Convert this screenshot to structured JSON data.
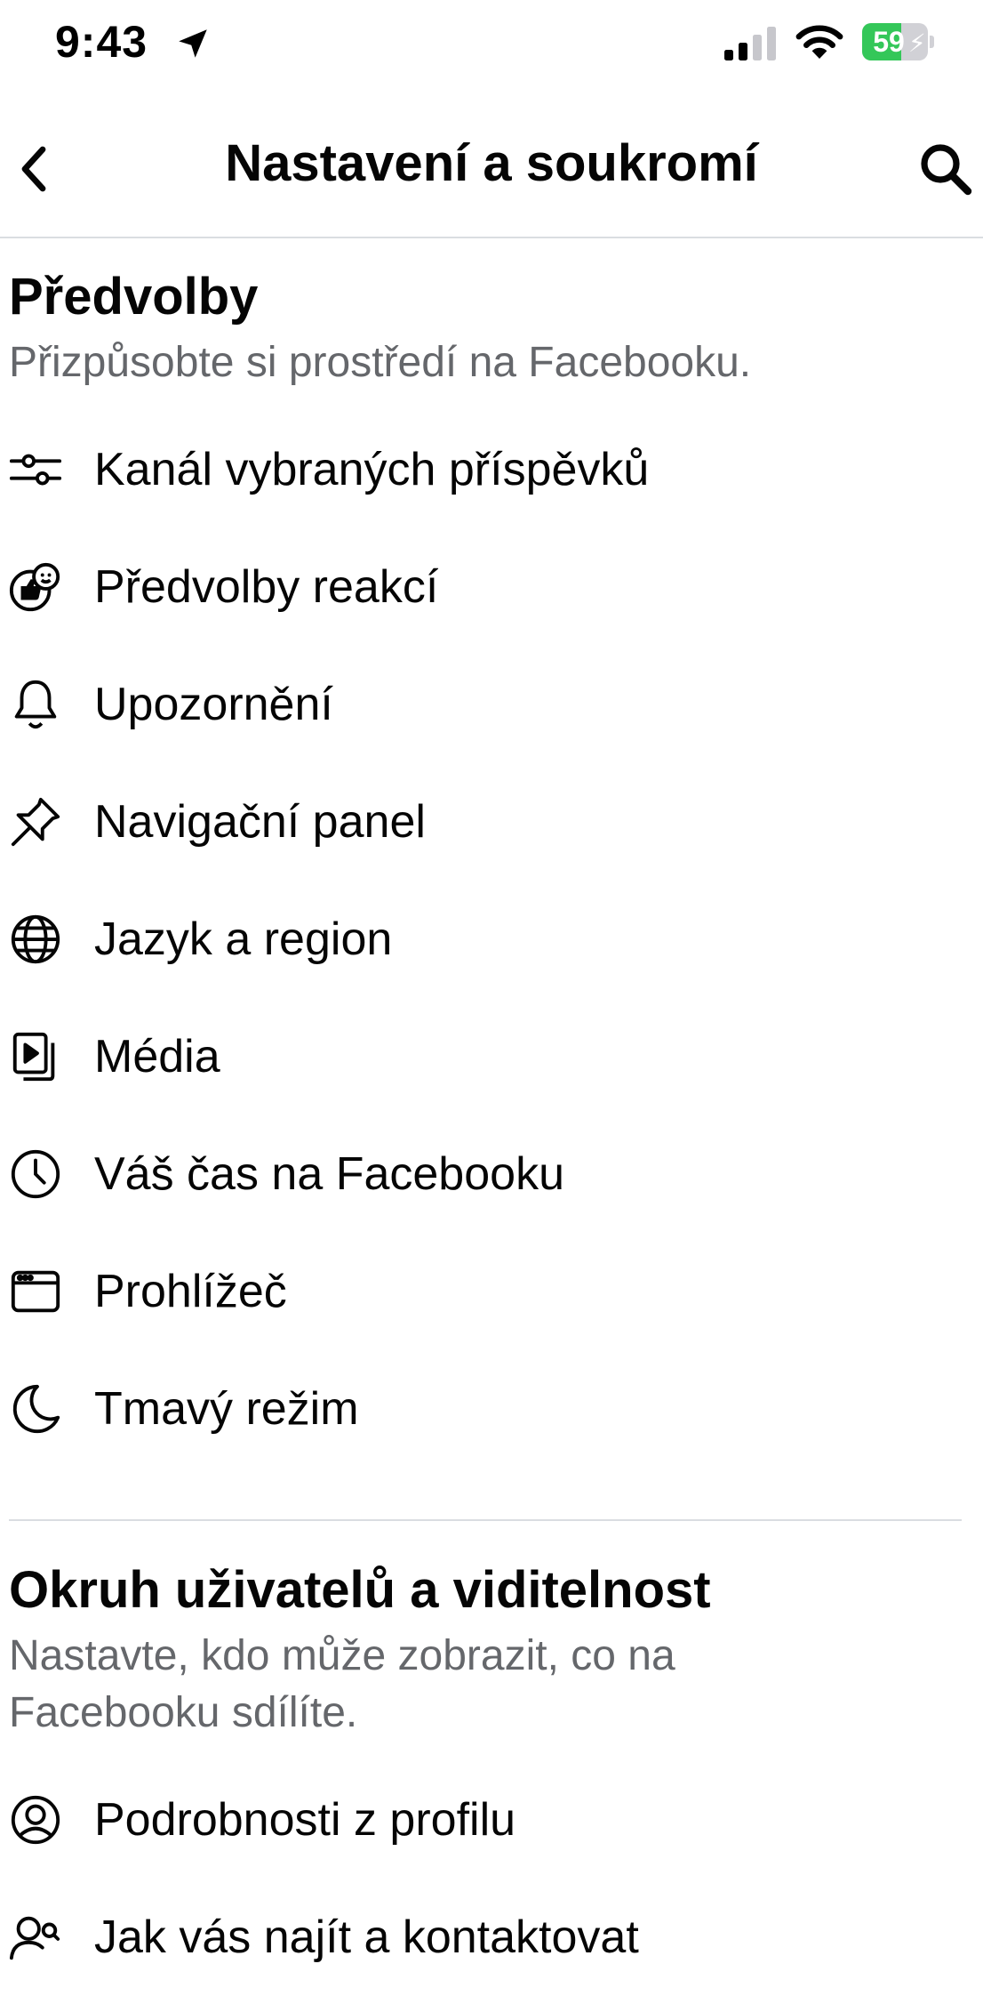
{
  "status_bar": {
    "time": "9:43",
    "battery_percent": "59",
    "battery_level": 0.59,
    "battery_color": "#34c759",
    "icons": [
      "location-arrow-icon",
      "cellular-signal-icon",
      "wifi-icon",
      "battery-charging-icon"
    ]
  },
  "header": {
    "title": "Nastavení a soukromí",
    "back_icon": "chevron-left-icon",
    "search_icon": "search-icon"
  },
  "preferences": {
    "title": "Předvolby",
    "subtitle": "Přizpůsobte si prostředí na Facebooku.",
    "items": [
      {
        "label": "Kanál vybraných příspěvků",
        "icon": "sliders-icon"
      },
      {
        "label": "Předvolby reakcí",
        "icon": "reactions-icon"
      },
      {
        "label": "Upozornění",
        "icon": "bell-icon"
      },
      {
        "label": "Navigační panel",
        "icon": "pin-icon"
      },
      {
        "label": "Jazyk a region",
        "icon": "globe-icon"
      },
      {
        "label": "Média",
        "icon": "media-icon"
      },
      {
        "label": "Váš čas na Facebooku",
        "icon": "clock-icon"
      },
      {
        "label": "Prohlížeč",
        "icon": "browser-icon"
      },
      {
        "label": "Tmavý režim",
        "icon": "moon-icon"
      }
    ]
  },
  "audience": {
    "title": "Okruh uživatelů a viditelnost",
    "subtitle": "Nastavte, kdo může zobrazit, co na Facebooku sdílíte.",
    "items": [
      {
        "label": "Podrobnosti z profilu",
        "icon": "profile-icon"
      },
      {
        "label": "Jak vás najít a kontaktovat",
        "icon": "find-contact-icon"
      }
    ]
  }
}
